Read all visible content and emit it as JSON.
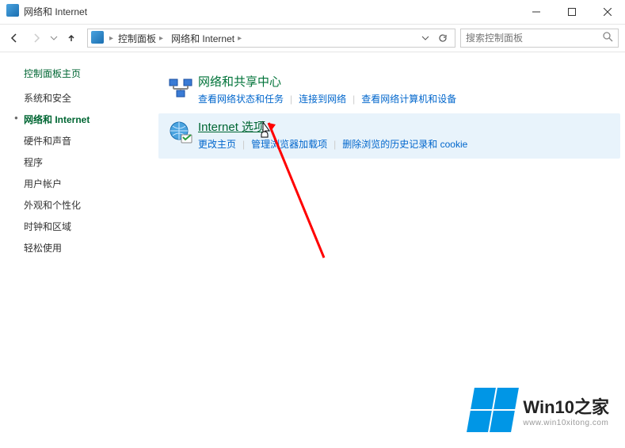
{
  "title": "网络和 Internet",
  "breadcrumbs": [
    "控制面板",
    "网络和 Internet"
  ],
  "search_placeholder": "搜索控制面板",
  "sidebar": {
    "head": "控制面板主页",
    "items": [
      {
        "label": "系统和安全",
        "active": false
      },
      {
        "label": "网络和 Internet",
        "active": true
      },
      {
        "label": "硬件和声音",
        "active": false
      },
      {
        "label": "程序",
        "active": false
      },
      {
        "label": "用户帐户",
        "active": false
      },
      {
        "label": "外观和个性化",
        "active": false
      },
      {
        "label": "时钟和区域",
        "active": false
      },
      {
        "label": "轻松使用",
        "active": false
      }
    ]
  },
  "sections": [
    {
      "heading": "网络和共享中心",
      "links": [
        "查看网络状态和任务",
        "连接到网络",
        "查看网络计算机和设备"
      ],
      "hover": false
    },
    {
      "heading": "Internet 选项",
      "links": [
        "更改主页",
        "管理浏览器加载项",
        "删除浏览的历史记录和 cookie"
      ],
      "hover": true
    }
  ],
  "watermark": {
    "title": "Win10之家",
    "sub": "www.win10xitong.com"
  }
}
